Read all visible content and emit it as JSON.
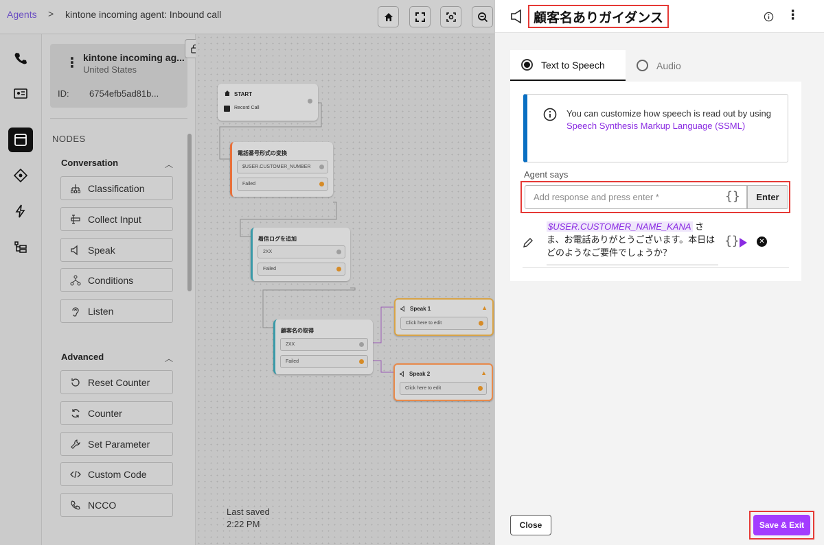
{
  "breadcrumb": {
    "root": "Agents",
    "separator": ">",
    "current": "kintone incoming agent: Inbound call"
  },
  "agent_card": {
    "name": "kintone incoming ag...",
    "country": "United States",
    "id_label": "ID:",
    "id_value": "6754efb5ad81b..."
  },
  "nodes_panel": {
    "title": "NODES",
    "groups": [
      {
        "title": "Conversation",
        "items": [
          "Classification",
          "Collect Input",
          "Speak",
          "Conditions",
          "Listen"
        ]
      },
      {
        "title": "Advanced",
        "items": [
          "Reset Counter",
          "Counter",
          "Set Parameter",
          "Custom Code",
          "NCCO"
        ]
      }
    ]
  },
  "canvas": {
    "nodes": [
      {
        "title": "START",
        "rows": [
          "Record Call"
        ]
      },
      {
        "title": "電話番号形式の変換",
        "rows": [
          "$USER.CUSTOMER_NUMBER",
          "Failed"
        ]
      },
      {
        "title": "着信ログを追加",
        "rows": [
          "2XX",
          "Failed"
        ]
      },
      {
        "title": "顧客名の取得",
        "rows": [
          "2XX",
          "Failed"
        ]
      },
      {
        "title": "Speak 1",
        "rows": [
          "Click here to edit"
        ]
      },
      {
        "title": "Speak 2",
        "rows": [
          "Click here to edit"
        ]
      }
    ],
    "last_saved_label": "Last saved",
    "last_saved_time": "2:22 PM"
  },
  "panel": {
    "title": "顧客名ありガイダンス",
    "tabs": [
      {
        "label": "Text to Speech",
        "selected": true
      },
      {
        "label": "Audio",
        "selected": false
      }
    ],
    "info_text_prefix": "You can customize how speech is read out by using ",
    "info_link": "Speech Synthesis Markup Language (SSML)",
    "agent_says_label": "Agent says",
    "input_placeholder": "Add response and press enter *",
    "braces_symbol": "{}",
    "enter_label": "Enter",
    "response": {
      "variable": "$USER.CUSTOMER_NAME_KANA",
      "text": " さま、お電話ありがとうございます。本日はどのようなご要件でしょうか？"
    },
    "close_label": "Close",
    "save_label": "Save & Exit"
  },
  "colors": {
    "accent": "#a33cff",
    "link": "#8a2be2",
    "info_bar": "#0a6fc2",
    "highlight": "#e53935"
  }
}
